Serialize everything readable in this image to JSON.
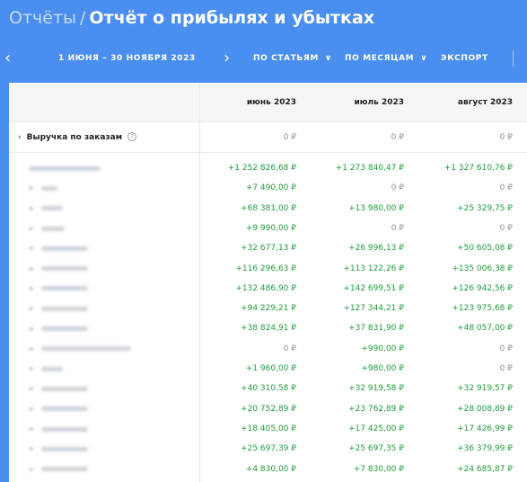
{
  "header": {
    "breadcrumb": "Отчёты",
    "separator": "/",
    "title": "Отчёт о прибылях и убытках"
  },
  "toolbar": {
    "date_range": "1 июня – 30 ноября 2023",
    "by_items": "по статьям",
    "by_months": "по месяцам",
    "export": "экспорт"
  },
  "table": {
    "columns": [
      "июнь 2023",
      "июль 2023",
      "август 2023"
    ],
    "revenue_row": {
      "label": "Выручка по заказам",
      "help": "?",
      "expand": "›",
      "values": [
        "0 ₽",
        "0 ₽",
        "0 ₽"
      ]
    },
    "rows": [
      {
        "values": [
          "+1 252 826,68 ₽",
          "+1 273 840,47 ₽",
          "+1 327 610,76 ₽"
        ]
      },
      {
        "values": [
          "+7 490,00 ₽",
          "0 ₽",
          "0 ₽"
        ]
      },
      {
        "values": [
          "+68 381,00 ₽",
          "+13 980,00 ₽",
          "+25 329,75 ₽"
        ]
      },
      {
        "values": [
          "+9 990,00 ₽",
          "0 ₽",
          "0 ₽"
        ]
      },
      {
        "values": [
          "+32 677,13 ₽",
          "+26 996,13 ₽",
          "+50 605,08 ₽"
        ]
      },
      {
        "values": [
          "+116 296,63 ₽",
          "+113 122,26 ₽",
          "+135 006,38 ₽"
        ]
      },
      {
        "values": [
          "+132 486,90 ₽",
          "+142 699,51 ₽",
          "+126 942,56 ₽"
        ]
      },
      {
        "values": [
          "+94 229,21 ₽",
          "+127 344,21 ₽",
          "+123 975,68 ₽"
        ]
      },
      {
        "values": [
          "+38 824,91 ₽",
          "+37 831,90 ₽",
          "+48 057,00 ₽"
        ]
      },
      {
        "values": [
          "0 ₽",
          "+990,00 ₽",
          "0 ₽"
        ]
      },
      {
        "values": [
          "+1 960,00 ₽",
          "+980,00 ₽",
          "0 ₽"
        ]
      },
      {
        "values": [
          "+40 310,58 ₽",
          "+32 919,58 ₽",
          "+32 919,57 ₽"
        ]
      },
      {
        "values": [
          "+20 752,89 ₽",
          "+23 762,89 ₽",
          "+28 008,89 ₽"
        ]
      },
      {
        "values": [
          "+18 405,00 ₽",
          "+17 425,00 ₽",
          "+17 426,99 ₽"
        ]
      },
      {
        "values": [
          "+25 697,39 ₽",
          "+25 697,35 ₽",
          "+36 379,99 ₽"
        ]
      },
      {
        "values": [
          "+4 830,00 ₽",
          "+7 830,00 ₽",
          "+24 685,87 ₽"
        ]
      }
    ]
  },
  "colors": {
    "header_bg": "#4a8ef0",
    "positive": "#1f9d3a",
    "zero": "#8c8f94"
  }
}
